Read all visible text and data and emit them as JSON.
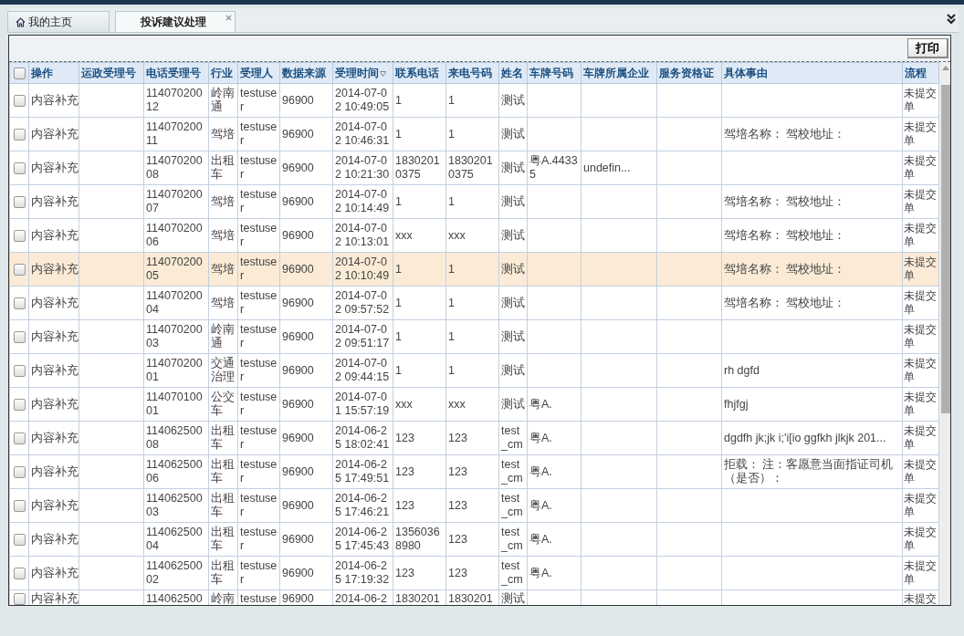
{
  "tabs": [
    {
      "label": "我的主页",
      "selected": false,
      "kind": "home",
      "closable": false
    },
    {
      "label": "投诉建议处理",
      "selected": true,
      "kind": "plain",
      "closable": true
    }
  ],
  "toolbar": {
    "buttons": [
      "打印"
    ]
  },
  "table": {
    "all_checked": false,
    "columns": [
      {
        "label": "操作",
        "sorted": false
      },
      {
        "label": "运政受理号",
        "sorted": false
      },
      {
        "label": "电话受理号",
        "sorted": false
      },
      {
        "label": "行业",
        "sorted": false
      },
      {
        "label": "受理人",
        "sorted": false
      },
      {
        "label": "数据来源",
        "sorted": false
      },
      {
        "label": "受理时间",
        "sorted": true
      },
      {
        "label": "联系电话",
        "sorted": false
      },
      {
        "label": "来电号码",
        "sorted": false
      },
      {
        "label": "姓名",
        "sorted": false
      },
      {
        "label": "车牌号码",
        "sorted": false
      },
      {
        "label": "车牌所属企业",
        "sorted": false
      },
      {
        "label": "服务资格证",
        "sorted": false
      },
      {
        "label": "具体事由",
        "sorted": false
      },
      {
        "label": "流程",
        "sorted": false
      }
    ],
    "rows": [
      {
        "selected": false,
        "checked": false,
        "cells": [
          "内容补充",
          null,
          "11407020012",
          "岭南通",
          "testuser",
          "96900",
          "2014-07-02 10:49:05",
          "1",
          "1",
          "测试",
          null,
          null,
          null,
          null,
          "未提交单"
        ]
      },
      {
        "selected": false,
        "checked": false,
        "cells": [
          "内容补充",
          null,
          "11407020011",
          "驾培",
          "testuser",
          "96900",
          "2014-07-02 10:46:31",
          "1",
          "1",
          "测试",
          null,
          null,
          null,
          "驾培名称： 驾校地址：",
          "未提交单"
        ]
      },
      {
        "selected": false,
        "checked": false,
        "cells": [
          "内容补充",
          null,
          "11407020008",
          "出租车",
          "testuser",
          "96900",
          "2014-07-02 10:21:30",
          "18302010375",
          "18302010375",
          "测试",
          "粤A.44335",
          "undefin...",
          null,
          null,
          "未提交单"
        ]
      },
      {
        "selected": false,
        "checked": false,
        "cells": [
          "内容补充",
          null,
          "11407020007",
          "驾培",
          "testuser",
          "96900",
          "2014-07-02 10:14:49",
          "1",
          "1",
          "测试",
          null,
          null,
          null,
          "驾培名称： 驾校地址：",
          "未提交单"
        ]
      },
      {
        "selected": false,
        "checked": false,
        "cells": [
          "内容补充",
          null,
          "11407020006",
          "驾培",
          "testuser",
          "96900",
          "2014-07-02 10:13:01",
          "xxx",
          "xxx",
          "测试",
          null,
          null,
          null,
          "驾培名称： 驾校地址：",
          "未提交单"
        ]
      },
      {
        "selected": true,
        "checked": false,
        "cells": [
          "内容补充",
          null,
          "11407020005",
          "驾培",
          "testuser",
          "96900",
          "2014-07-02 10:10:49",
          "1",
          "1",
          "测试",
          null,
          null,
          null,
          "驾培名称： 驾校地址：",
          "未提交单"
        ]
      },
      {
        "selected": false,
        "checked": false,
        "cells": [
          "内容补充",
          null,
          "11407020004",
          "驾培",
          "testuser",
          "96900",
          "2014-07-02 09:57:52",
          "1",
          "1",
          "测试",
          null,
          null,
          null,
          "驾培名称： 驾校地址：",
          "未提交单"
        ]
      },
      {
        "selected": false,
        "checked": false,
        "cells": [
          "内容补充",
          null,
          "11407020003",
          "岭南通",
          "testuser",
          "96900",
          "2014-07-02 09:51:17",
          "1",
          "1",
          "测试",
          null,
          null,
          null,
          null,
          "未提交单"
        ]
      },
      {
        "selected": false,
        "checked": false,
        "cells": [
          "内容补充",
          null,
          "11407020001",
          "交通治理",
          "testuser",
          "96900",
          "2014-07-02 09:44:15",
          "1",
          "1",
          "测试",
          null,
          null,
          null,
          "rh dgfd",
          "未提交单"
        ]
      },
      {
        "selected": false,
        "checked": false,
        "cells": [
          "内容补充",
          null,
          "11407010001",
          "公交车",
          "testuser",
          "96900",
          "2014-07-01 15:57:19",
          "xxx",
          "xxx",
          "测试",
          "粤A.",
          null,
          null,
          "fhjfgj",
          "未提交单"
        ]
      },
      {
        "selected": false,
        "checked": false,
        "cells": [
          "内容补充",
          null,
          "11406250008",
          "出租车",
          "testuser",
          "96900",
          "2014-06-25 18:02:41",
          "123",
          "123",
          "test_cm",
          "粤A.",
          null,
          null,
          "dgdfh jk;jk i;'i[io ggfkh jlkjk 201...",
          "未提交单"
        ]
      },
      {
        "selected": false,
        "checked": false,
        "cells": [
          "内容补充",
          null,
          "11406250006",
          "出租车",
          "testuser",
          "96900",
          "2014-06-25 17:49:51",
          "123",
          "123",
          "test_cm",
          "粤A.",
          null,
          null,
          "拒载： 注：客愿意当面指证司机（是否）：",
          "未提交单"
        ]
      },
      {
        "selected": false,
        "checked": false,
        "cells": [
          "内容补充",
          null,
          "11406250003",
          "出租车",
          "testuser",
          "96900",
          "2014-06-25 17:46:21",
          "123",
          "123",
          "test_cm",
          "粤A.",
          null,
          null,
          null,
          "未提交单"
        ]
      },
      {
        "selected": false,
        "checked": false,
        "cells": [
          "内容补充",
          null,
          "11406250004",
          "出租车",
          "testuser",
          "96900",
          "2014-06-25 17:45:43",
          "13560368980",
          "123",
          "test_cm",
          "粤A.",
          null,
          null,
          null,
          "未提交单"
        ]
      },
      {
        "selected": false,
        "checked": false,
        "cells": [
          "内容补充",
          null,
          "11406250002",
          "出租车",
          "testuser",
          "96900",
          "2014-06-25 17:19:32",
          "123",
          "123",
          "test_cm",
          "粤A.",
          null,
          null,
          null,
          "未提交单"
        ]
      },
      {
        "selected": false,
        "checked": false,
        "partial": true,
        "cells": [
          "内容补充",
          null,
          "114062500",
          "岭南",
          "testuse",
          "96900",
          "2014-06-2",
          "1830201",
          "1830201",
          "测试",
          null,
          null,
          null,
          null,
          "未提交"
        ]
      }
    ]
  }
}
